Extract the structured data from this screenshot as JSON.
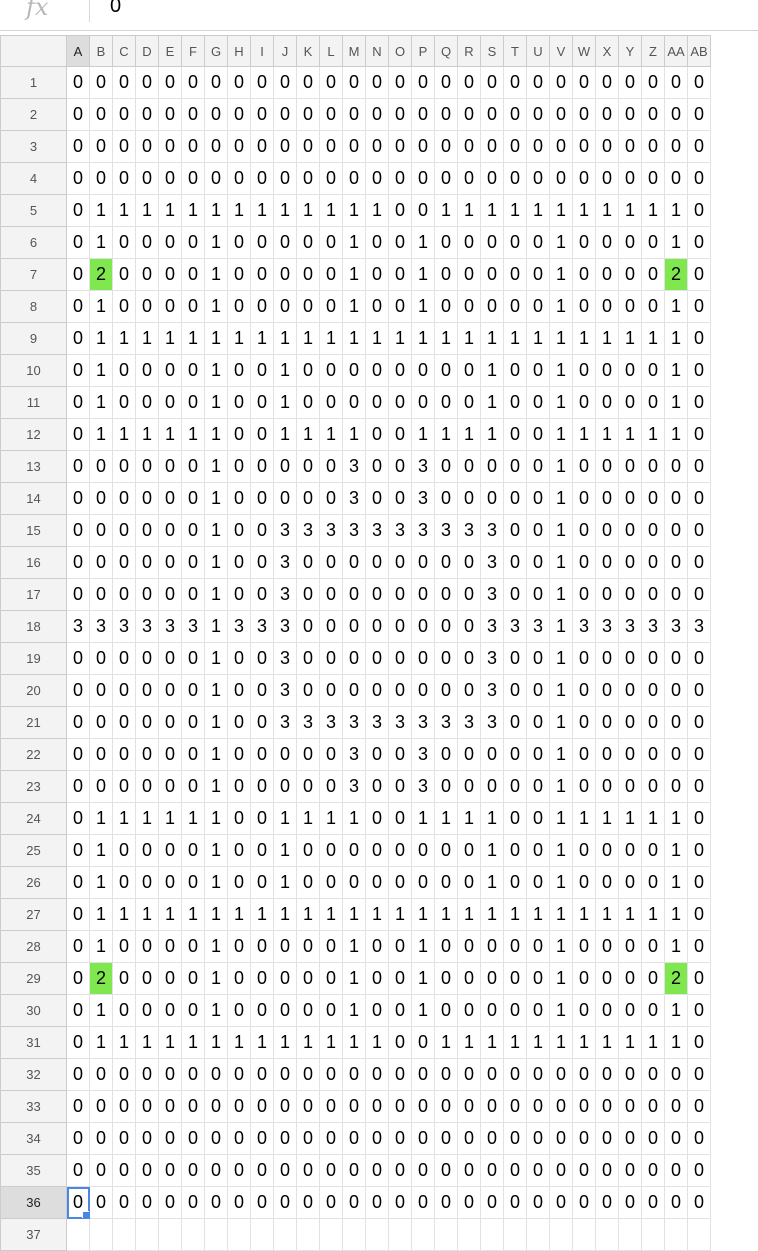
{
  "formula_bar": {
    "icon": "fx",
    "value": "0"
  },
  "column_headers": [
    "A",
    "B",
    "C",
    "D",
    "E",
    "F",
    "G",
    "H",
    "I",
    "J",
    "K",
    "L",
    "M",
    "N",
    "O",
    "P",
    "Q",
    "R",
    "S",
    "T",
    "U",
    "V",
    "W",
    "X",
    "Y",
    "Z",
    "AA",
    "AB"
  ],
  "active_column": "A",
  "active_row": 36,
  "selected_cell": "A36",
  "highlight_color": "#7ee84e",
  "selection_color": "#4a86e8",
  "highlighted_cells": [
    "B7",
    "AA7",
    "B29",
    "AA29"
  ],
  "rows": [
    {
      "num": "1",
      "cells": "0000000000000000000000000000"
    },
    {
      "num": "2",
      "cells": "0000000000000000000000000000"
    },
    {
      "num": "3",
      "cells": "0000000000000000000000000000"
    },
    {
      "num": "4",
      "cells": "0000000000000000000000000000"
    },
    {
      "num": "5",
      "cells": "0111111111111100111111111110"
    },
    {
      "num": "6",
      "cells": "0100001000001001000001000010"
    },
    {
      "num": "7",
      "cells": "0200001000001001000001000020"
    },
    {
      "num": "8",
      "cells": "0100001000001001000001000010"
    },
    {
      "num": "9",
      "cells": "0111111111111111111111111110"
    },
    {
      "num": "10",
      "cells": "0100001001000000001001000010"
    },
    {
      "num": "11",
      "cells": "0100001001000000001001000010"
    },
    {
      "num": "12",
      "cells": "0111111001111001111001111110"
    },
    {
      "num": "13",
      "cells": "0000001000003003000001000000"
    },
    {
      "num": "14",
      "cells": "0000001000003003000001000000"
    },
    {
      "num": "15",
      "cells": "0000001003333333333001000000"
    },
    {
      "num": "16",
      "cells": "0000001003000000003001000000"
    },
    {
      "num": "17",
      "cells": "0000001003000000003001000000"
    },
    {
      "num": "18",
      "cells": "3333331333000000003331333333"
    },
    {
      "num": "19",
      "cells": "0000001003000000003001000000"
    },
    {
      "num": "20",
      "cells": "0000001003000000003001000000"
    },
    {
      "num": "21",
      "cells": "0000001003333333333001000000"
    },
    {
      "num": "22",
      "cells": "0000001000003003000001000000"
    },
    {
      "num": "23",
      "cells": "0000001000003003000001000000"
    },
    {
      "num": "24",
      "cells": "0111111001111001111001111110"
    },
    {
      "num": "25",
      "cells": "0100001001000000001001000010"
    },
    {
      "num": "26",
      "cells": "0100001001000000001001000010"
    },
    {
      "num": "27",
      "cells": "0111111111111111111111111110"
    },
    {
      "num": "28",
      "cells": "0100001000001001000001000010"
    },
    {
      "num": "29",
      "cells": "0200001000001001000001000020"
    },
    {
      "num": "30",
      "cells": "0100001000001001000001000010"
    },
    {
      "num": "31",
      "cells": "0111111111111100111111111110"
    },
    {
      "num": "32",
      "cells": "0000000000000000000000000000"
    },
    {
      "num": "33",
      "cells": "0000000000000000000000000000"
    },
    {
      "num": "34",
      "cells": "0000000000000000000000000000"
    },
    {
      "num": "35",
      "cells": "0000000000000000000000000000"
    },
    {
      "num": "36",
      "cells": "0000000000000000000000000000"
    },
    {
      "num": "37",
      "cells": ""
    }
  ]
}
